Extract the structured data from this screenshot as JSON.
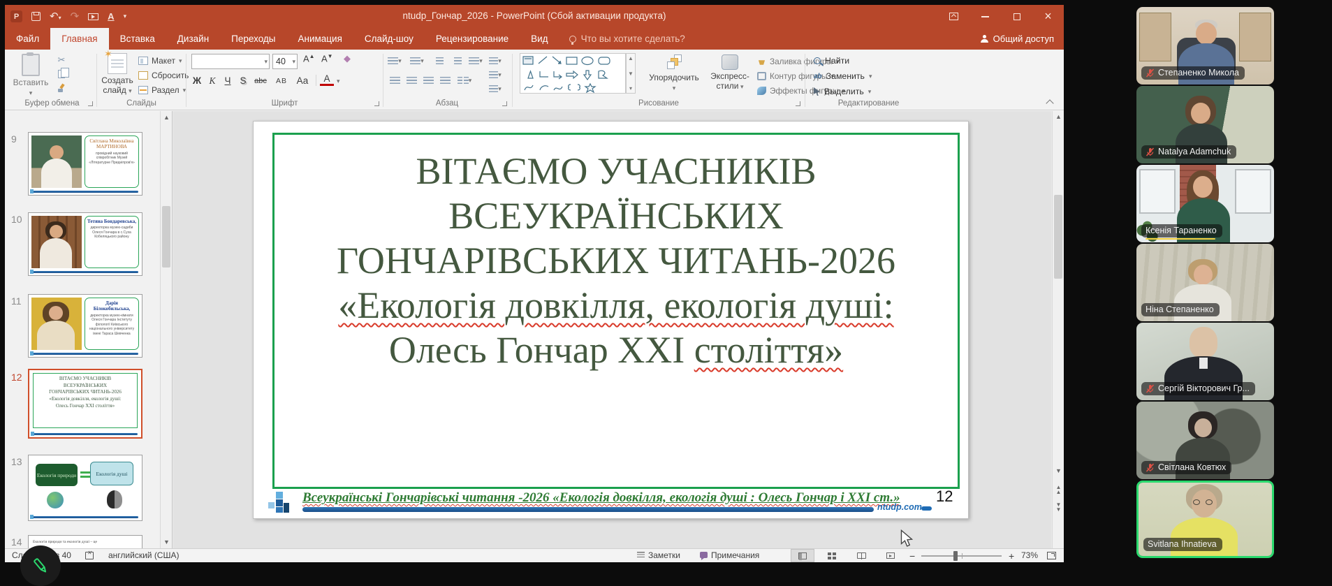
{
  "window": {
    "title": "ntudp_Гончар_2026 - PowerPoint (Сбой активации продукта)",
    "tell_me": "Что вы хотите сделать?",
    "share": "Общий доступ",
    "app_initial": "P"
  },
  "tabs": [
    "Файл",
    "Главная",
    "Вставка",
    "Дизайн",
    "Переходы",
    "Анимация",
    "Слайд-шоу",
    "Рецензирование",
    "Вид"
  ],
  "ribbon": {
    "clipboard": {
      "label": "Буфер обмена",
      "paste": "Вставить"
    },
    "slides": {
      "label": "Слайды",
      "new_slide": "Создать слайд",
      "layout": "Макет",
      "reset": "Сбросить",
      "section": "Раздел"
    },
    "font": {
      "label": "Шрифт",
      "size": "40",
      "bold": "Ж",
      "italic": "К",
      "underline": "Ч",
      "shadow": "S",
      "strike": "abc",
      "spacing": "АВ",
      "case": "Аа",
      "color": "А"
    },
    "paragraph": {
      "label": "Абзац"
    },
    "drawing": {
      "label": "Рисование",
      "arrange": "Упорядочить",
      "quick_styles_1": "Экспресс-",
      "quick_styles_2": "стили",
      "fill": "Заливка фигуры",
      "outline": "Контур фигуры",
      "effects": "Эффекты фигуры"
    },
    "editing": {
      "label": "Редактирование",
      "find": "Найти",
      "replace": "Заменить",
      "select": "Выделить"
    }
  },
  "thumbnails": [
    {
      "number": "9",
      "name": "Світлана Миколаївна МАРТИНОВА",
      "role": "провідний науковий співробітник Музей «Літературне Придніпров'я»"
    },
    {
      "number": "10",
      "name": "Тетяна Бондаревська,",
      "role": "директорка музею-садиби Олеся Гончара в с.Суха Кобеляцького району"
    },
    {
      "number": "11",
      "name": "Дарія Білокобильська,",
      "role": "директорка музею-кімнати Олеся Гончара Інституту філології Київського національного університету імені Тараса Шевченка"
    },
    {
      "number": "12",
      "lines": [
        "ВІТАЄМО УЧАСНИКІВ",
        "ВСЕУКРАЇНСЬКИХ",
        "ГОНЧАРІВСЬКИХ ЧИТАНЬ-2026",
        "«Екологія довкілля, екологія душі:",
        "Олесь Гончар  XXI століття»"
      ]
    },
    {
      "number": "13",
      "box_left": "Екологія природи",
      "box_right": "Екологія душі"
    },
    {
      "number": "14",
      "text": "Екологія природи та екологія душі – це"
    }
  ],
  "slide": {
    "line1": "ВІТАЄМО УЧАСНИКІВ",
    "line2": "ВСЕУКРАЇНСЬКИХ",
    "line3": "ГОНЧАРІВСЬКИХ ЧИТАНЬ-2026",
    "line4": "«Екологія довкілля, екологія душі:",
    "line5_plain": "Олесь Гончар  XXI ",
    "line5_wavy": "століття»",
    "footer": "Всеукраїнські Гончарівські читання -2026 «Екологія довкілля, екологія душі :  Олесь Гончар і XXI ст.»",
    "site": "ntudp.com",
    "number": "12"
  },
  "statusbar": {
    "slide_info": "Слайд 12 из 40",
    "language": "английский (США)",
    "notes": "Заметки",
    "comments": "Примечания",
    "zoom_level": "73%"
  },
  "participants": [
    {
      "name": "Степаненко Микола",
      "muted": true
    },
    {
      "name": "Natalya Adamchuk",
      "muted": true
    },
    {
      "name": "Ксенія Тараненко",
      "muted": false
    },
    {
      "name": "Ніна Степаненко",
      "muted": false
    },
    {
      "name": "Сергій Вікторович Гр...",
      "muted": true
    },
    {
      "name": "Світлана Ковтюх",
      "muted": true
    },
    {
      "name": "Svitlana Ihnatieva",
      "muted": false
    }
  ],
  "colors": {
    "titlebar": "#b7472a",
    "selection_border": "#d04f2a",
    "slide_green_border": "#1ba04e",
    "active_speaker": "#2bd96e",
    "muted_mic": "#e05246"
  }
}
